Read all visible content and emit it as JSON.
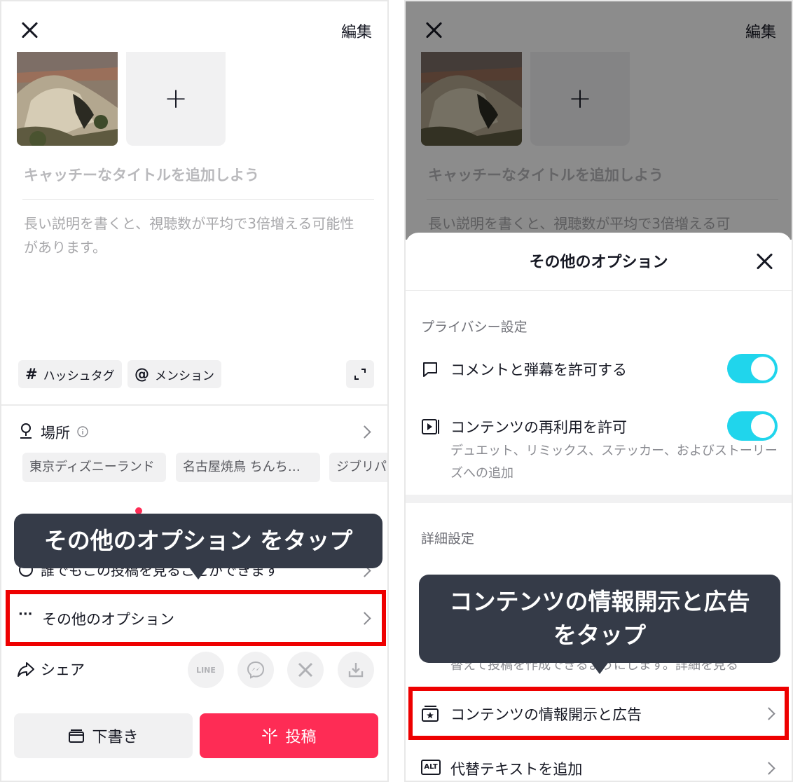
{
  "left": {
    "header": {
      "edit_label": "編集"
    },
    "add_tile": {
      "plus": "+"
    },
    "title_placeholder": "キャッチーなタイトルを追加しよう",
    "description_placeholder": "長い説明を書くと、視聴数が平均で3倍増える可能性があります。",
    "chips": {
      "hashtag_symbol": "#",
      "hashtag": "ハッシュタグ",
      "mention_symbol": "@",
      "mention": "メンション"
    },
    "location": {
      "label": "場所",
      "suggestions": [
        "東京ディズニーランド",
        "名古屋焼鳥 ちんち…",
        "ジブリパ"
      ]
    },
    "visibility_text": "誰でもこの投稿を見ることができます",
    "more_options": {
      "dots": "···",
      "label": "その他のオプション"
    },
    "share": {
      "label": "シェア",
      "targets": [
        "line-icon",
        "messenger-icon",
        "x-icon",
        "download-icon"
      ],
      "line_text": "LINE"
    },
    "draft_button": "下書き",
    "post_button": "投稿",
    "callout": "その他のオプション をタップ"
  },
  "right": {
    "header": {
      "edit_label": "編集"
    },
    "add_tile": {
      "plus": "+"
    },
    "title_placeholder": "キャッチーなタイトルを追加しよう",
    "description_placeholder": "長い説明を書くと、視聴数が平均で3倍増える可",
    "sheet": {
      "title": "その他のオプション",
      "privacy_heading": "プライバシー設定",
      "allow_comments": "コメントと弾幕を許可する",
      "allow_comments_on": true,
      "allow_reuse": "コンテンツの再利用を許可",
      "allow_reuse_on": true,
      "allow_reuse_sub": "デュエット、リミックス、ステッカー、およびストーリーズへの追加",
      "advanced_heading": "詳細設定",
      "hidden_sub": "替えて投稿を作成できるようにします。詳細を見る",
      "disclosure": "コンテンツの情報開示と広告",
      "alt_text": "代替テキストを追加",
      "alt_badge": "ALT"
    },
    "callout_line1": "コンテンツの情報開示と広告",
    "callout_line2": "をタップ"
  },
  "colors": {
    "accent_pink": "#fe2c55",
    "toggle_on": "#20d5ec",
    "callout_bg": "#353b48",
    "highlight_red": "#ee0000"
  }
}
